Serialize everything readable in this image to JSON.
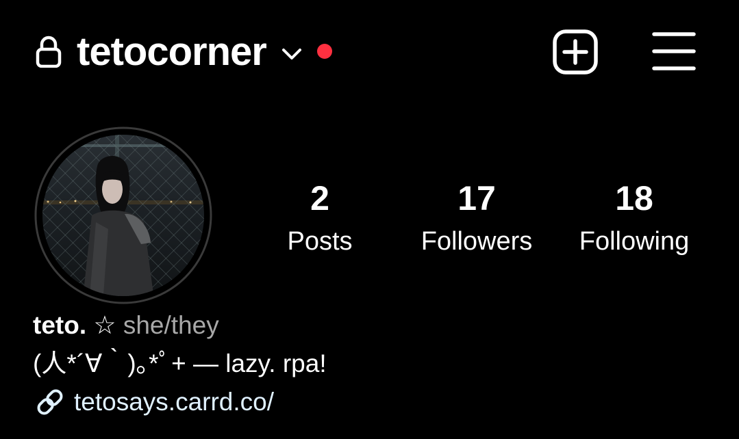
{
  "colors": {
    "background": "#000000",
    "text": "#ffffff",
    "notification_dot": "#ff3040",
    "pronouns_gray": "#a8a8a8",
    "link": "#e0f1ff"
  },
  "header": {
    "lock_icon": "lock-icon",
    "username": "tetocorner",
    "switch_account_icon": "chevron-down-icon",
    "create_icon": "plus-square-icon",
    "menu_icon": "hamburger-menu-icon"
  },
  "profile": {
    "avatar_icon": "profile-photo",
    "stats": {
      "posts": {
        "count": "2",
        "label": "Posts"
      },
      "followers": {
        "count": "17",
        "label": "Followers"
      },
      "following": {
        "count": "18",
        "label": "Following"
      }
    },
    "bio": {
      "display_name": "teto.",
      "separator": " ☆ ",
      "pronouns": "she/they",
      "text": "(人*´∀｀)｡*ﾟ+ — lazy. rpa!",
      "link_icon": "link-icon",
      "link": "tetosays.carrd.co/"
    }
  }
}
